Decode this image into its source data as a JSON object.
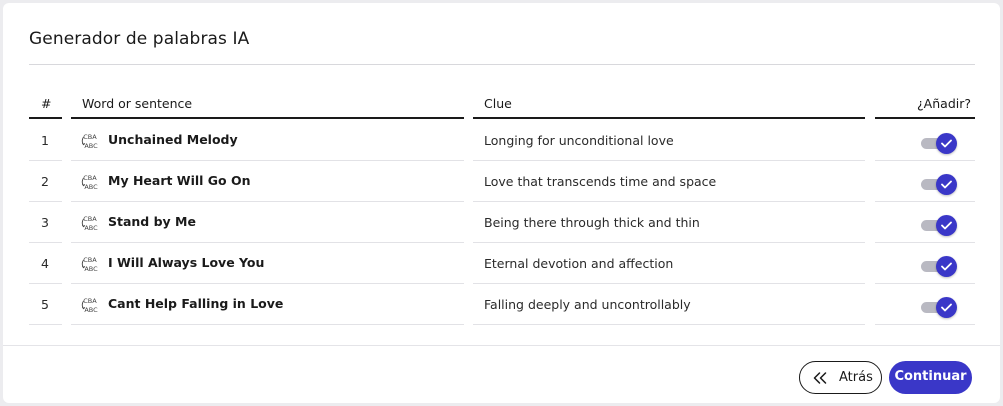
{
  "dialog": {
    "title": "Generador de palabras IA"
  },
  "table": {
    "headers": {
      "number": "#",
      "word": "Word or sentence",
      "clue": "Clue",
      "add": "¿Añadir?"
    },
    "rows": [
      {
        "number": "1",
        "word": "Unchained Melody",
        "clue": "Longing for unconditional love",
        "add": true
      },
      {
        "number": "2",
        "word": "My Heart Will Go On",
        "clue": "Love that transcends time and space",
        "add": true
      },
      {
        "number": "3",
        "word": "Stand by Me",
        "clue": "Being there through thick and thin",
        "add": true
      },
      {
        "number": "4",
        "word": "I Will Always Love You",
        "clue": "Eternal devotion and affection",
        "add": true
      },
      {
        "number": "5",
        "word": "Cant Help Falling in Love",
        "clue": "Falling deeply and uncontrollably",
        "add": true
      }
    ]
  },
  "footer": {
    "back_label": "Atrás",
    "continue_label": "Continuar"
  },
  "icons": {
    "word_icon": "spell-abc-icon",
    "back_icon": "double-chevron-left-icon",
    "toggle_icon": "check-icon"
  },
  "colors": {
    "accent": "#3a37c8",
    "track": "#b9b9c2"
  }
}
